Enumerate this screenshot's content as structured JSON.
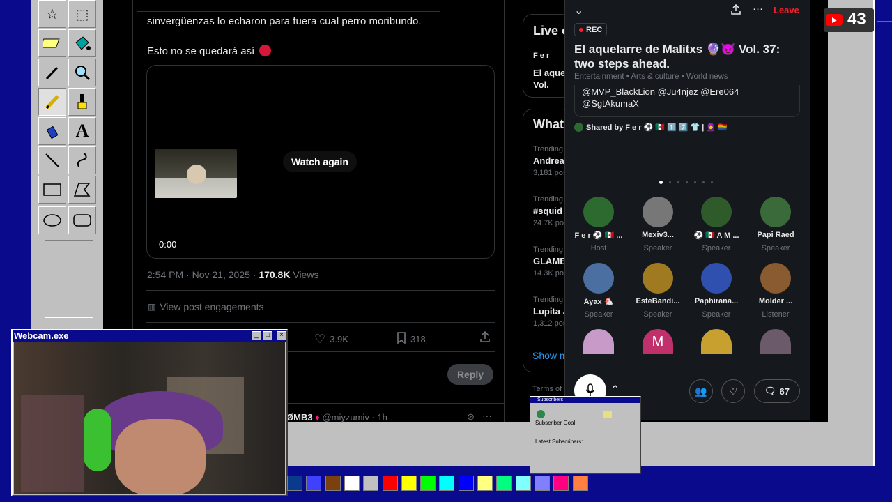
{
  "post": {
    "text_line1": "sinvergüenzas lo echaron para fuera cual perro moribundo.",
    "text_line2": "Esto no se quedará así",
    "watch_again": "Watch again",
    "video_time": "0:00",
    "timestamp": "2:54 PM · Nov 21, 2025 · ",
    "views_count": "170.8K",
    "views_label": " Views",
    "engagements": "View post engagements",
    "likes": "3.9K",
    "bookmarks": "318",
    "reply_button": "Reply",
    "reply_author": "ØMB3",
    "reply_handle": "@miyzumiv · 1h"
  },
  "sidebar": {
    "live_on_x": "Live o",
    "live_host": "F e r",
    "live_title": "El aquela",
    "live_vol": "Vol.",
    "whats": "What",
    "trends": [
      {
        "label": "Trending",
        "name": "Andrea",
        "count": "3,181 pos"
      },
      {
        "label": "Trending",
        "name": "#squid",
        "count": "24.7K po"
      },
      {
        "label": "Trending",
        "name": "GLAMB",
        "count": "14.3K po"
      },
      {
        "label": "Trending",
        "name": "Lupita J",
        "count": "1,312 pos"
      }
    ],
    "show_more": "Show m",
    "terms": "Terms of S"
  },
  "space": {
    "leave": "Leave",
    "rec": "REC",
    "title": "El aquelarre de Malitxs 🔮😈 Vol. 37: two steps ahead.",
    "tags": "Entertainment • Arts & culture • World news",
    "desc_line1": "@MVP_BlackLion @Ju4njez @Ere064",
    "desc_line2": "@SgtAkumaX",
    "shared_by": "Shared by F e r ⚽ 🇲🇽 1️⃣ 7️⃣ 👕 | 🧕 🏳️‍🌈",
    "speakers": [
      {
        "name": "F e r ⚽ 🇲🇽 ...",
        "role": "Host",
        "color": "#2d6a2f"
      },
      {
        "name": "Mexiv3...",
        "role": "Speaker",
        "color": "#777"
      },
      {
        "name": "⚽ 🇲🇽 A M ...",
        "role": "Speaker",
        "color": "#2f5a2a"
      },
      {
        "name": "Papi Raed",
        "role": "Speaker",
        "color": "#3a6a3a"
      },
      {
        "name": "Ayax 🐔",
        "role": "Speaker",
        "color": "#4a6fa0"
      },
      {
        "name": "EsteBandi...",
        "role": "Speaker",
        "color": "#a07a20"
      },
      {
        "name": "Paphirana...",
        "role": "Speaker",
        "color": "#3050b0"
      },
      {
        "name": "Molder ...",
        "role": "Listener",
        "color": "#8a5a30"
      }
    ],
    "row3_colors": [
      "#c89ac8",
      "#c0306a",
      "#c8a030",
      "#6a5a6a"
    ],
    "row3_initial": "M",
    "comment_count": "67"
  },
  "webcam": {
    "title": "Webcam.exe"
  },
  "palette": [
    "#0a3a8c",
    "#4040ff",
    "#7a4010",
    "#ffffff",
    "#c0c0c0",
    "#ff0000",
    "#ffff00",
    "#00ff00",
    "#00ffff",
    "#0000ff",
    "#ffff80",
    "#00ff80",
    "#80ffff",
    "#8080ff",
    "#ff0080",
    "#ff8040"
  ],
  "subscribers": {
    "title": "Subscribers",
    "goal": "Subscriber Goal:",
    "latest": "Latest Subscribers:"
  },
  "youtube": {
    "count": "43"
  }
}
